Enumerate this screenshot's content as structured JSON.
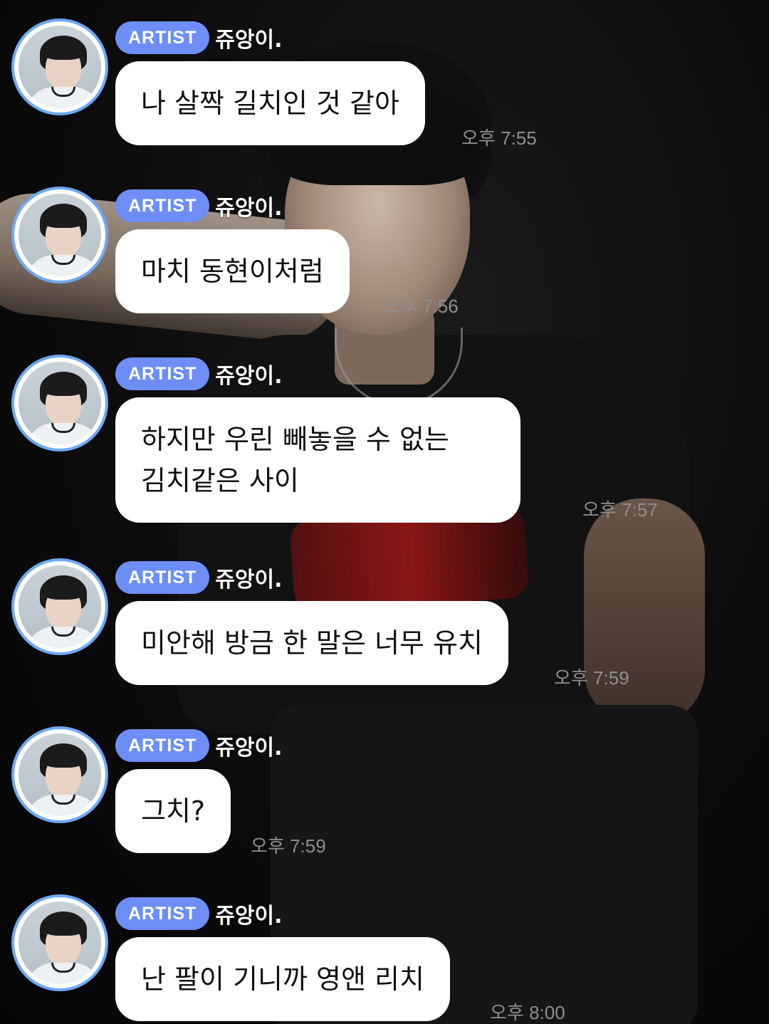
{
  "badge_label": "ARTIST",
  "sender_name": "쥬앙이.",
  "messages": [
    {
      "text": "나 살짝 길치인 것 같아",
      "time": "오후 7:55"
    },
    {
      "text": "마치 동현이처럼",
      "time": "오후 7:56"
    },
    {
      "text": "하지만 우린 빼놓을 수 없는",
      "text_line2": "김치같은 사이",
      "time": "오후 7:57"
    },
    {
      "text": "미안해 방금 한 말은 너무 유치",
      "time": "오후 7:59"
    },
    {
      "text": "그치?",
      "time": "오후 7:59"
    },
    {
      "text": "난 팔이 기니까 영앤 리치",
      "time": "오후 8:00"
    }
  ],
  "colors": {
    "badge_bg": "#6d8ef6",
    "avatar_ring": "#6ea9f5",
    "bubble_bg": "#ffffff",
    "time_text": "#8e8e8e"
  },
  "icons": [
    "artist-avatar-icon"
  ]
}
